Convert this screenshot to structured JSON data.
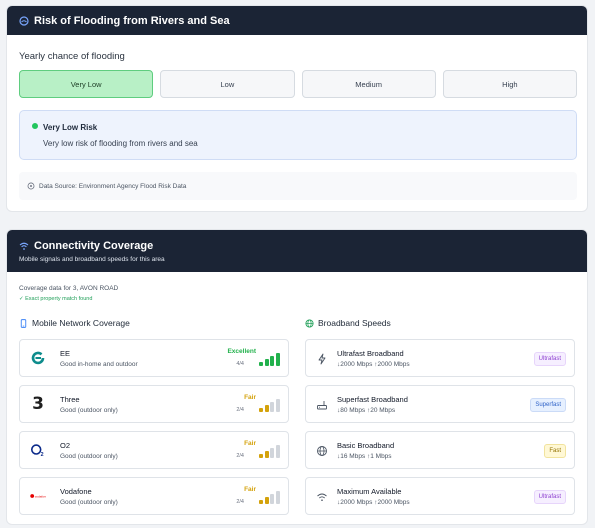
{
  "flood": {
    "title": "Risk of Flooding from Rivers and Sea",
    "subtitle": "Yearly chance of flooding",
    "levels": [
      "Very Low",
      "Low",
      "Medium",
      "High"
    ],
    "selected_level": "Very Low",
    "risk_title": "Very Low Risk",
    "risk_description": "Very low risk of flooding from rivers and sea",
    "source": "Data Source: Environment Agency Flood Risk Data"
  },
  "connectivity": {
    "title": "Connectivity Coverage",
    "subtitle": "Mobile signals and broadband speeds for this area",
    "coverage_for": "Coverage data for 3, AVON ROAD",
    "match": "✓ Exact property match found",
    "mobile_title": "Mobile Network Coverage",
    "broadband_title": "Broadband Speeds",
    "mobile": [
      {
        "name": "EE",
        "desc": "Good in-home and outdoor",
        "rating": "Excellent",
        "score": "4/4",
        "bars": 4,
        "color": "#22b14c",
        "logo": "ee-logo"
      },
      {
        "name": "Three",
        "desc": "Good (outdoor only)",
        "rating": "Fair",
        "score": "2/4",
        "bars": 2,
        "color": "#d4a20b",
        "logo": "three-logo"
      },
      {
        "name": "O2",
        "desc": "Good (outdoor only)",
        "rating": "Fair",
        "score": "2/4",
        "bars": 2,
        "color": "#d4a20b",
        "logo": "o2-logo"
      },
      {
        "name": "Vodafone",
        "desc": "Good (outdoor only)",
        "rating": "Fair",
        "score": "2/4",
        "bars": 2,
        "color": "#d4a20b",
        "logo": "vodafone-logo"
      }
    ],
    "broadband": [
      {
        "name": "Ultrafast Broadband",
        "speed": "↓2000 Mbps ↑2000 Mbps",
        "badge": "Ultrafast",
        "badge_style": "ultra",
        "icon": "lightning-icon"
      },
      {
        "name": "Superfast Broadband",
        "speed": "↓80 Mbps ↑20 Mbps",
        "badge": "Superfast",
        "badge_style": "super",
        "icon": "router-icon"
      },
      {
        "name": "Basic Broadband",
        "speed": "↓16 Mbps ↑1 Mbps",
        "badge": "Fast",
        "badge_style": "fast",
        "icon": "globe-icon"
      },
      {
        "name": "Maximum Available",
        "speed": "↓2000 Mbps ↑2000 Mbps",
        "badge": "Ultrafast",
        "badge_style": "ultra",
        "icon": "wifi-icon"
      }
    ],
    "vodafone_logo_text": "vodafone"
  },
  "colors": {
    "header_bg": "#1b2435",
    "selected_level_bg": "#b8f0c6",
    "risk_dot": "#22c55e",
    "excellent": "#22b14c",
    "fair": "#d4a20b",
    "inactive_bar": "#d1d5db"
  }
}
